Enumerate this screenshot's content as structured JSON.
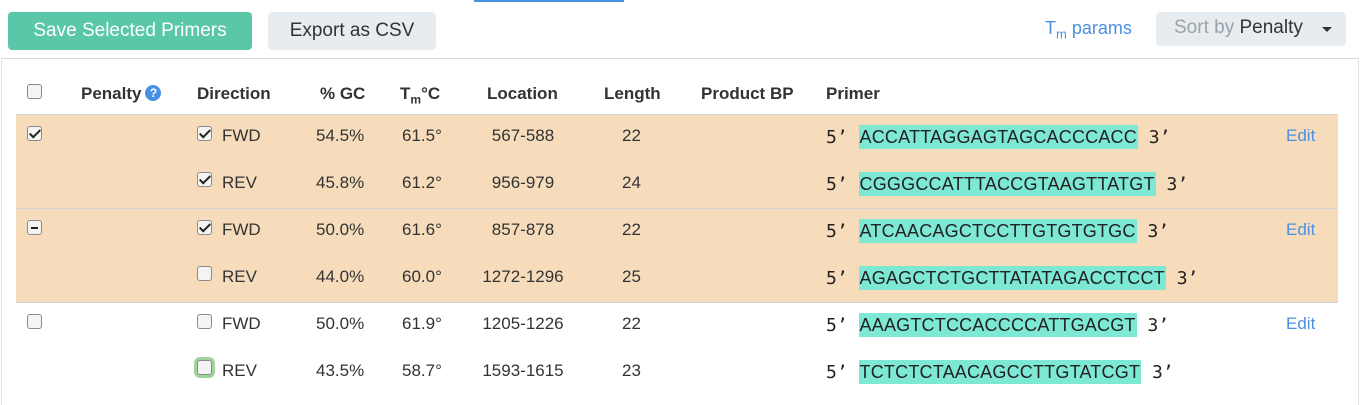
{
  "toolbar": {
    "save_label": "Save Selected Primers",
    "export_label": "Export as CSV",
    "tm_link": {
      "main": "T",
      "sub": "m",
      "rest": " params"
    },
    "sort": {
      "prefix": "Sort by ",
      "value": "Penalty"
    }
  },
  "columns": {
    "penalty": "Penalty",
    "direction": "Direction",
    "gc": "% GC",
    "tm": {
      "main": "T",
      "sub": "m",
      "rest": "°C"
    },
    "location": "Location",
    "length": "Length",
    "product_bp": "Product BP",
    "primer": "Primer"
  },
  "help_glyph": "?",
  "prime5": "5’",
  "prime3": "3’",
  "edit_label": "Edit",
  "colors": {
    "accent_green": "#5ac8a8",
    "selected_row": "#f7dcbc",
    "sequence_highlight": "#7de8d4",
    "link": "#4a90e2"
  },
  "pairs": [
    {
      "pair_state": "checked",
      "rows": [
        {
          "checked": true,
          "direction": "FWD",
          "gc": "54.5%",
          "tm": "61.5°",
          "location": "567-588",
          "length": "22",
          "product_bp": "",
          "sequence": "ACCATTAGGAGTAGCACCCACC"
        },
        {
          "checked": true,
          "direction": "REV",
          "gc": "45.8%",
          "tm": "61.2°",
          "location": "956-979",
          "length": "24",
          "product_bp": "",
          "sequence": "CGGGCCATTTACCGTAAGTTATGT"
        }
      ]
    },
    {
      "pair_state": "mixed",
      "rows": [
        {
          "checked": true,
          "direction": "FWD",
          "gc": "50.0%",
          "tm": "61.6°",
          "location": "857-878",
          "length": "22",
          "product_bp": "",
          "sequence": "ATCAACAGCTCCTTGTGTGTGC"
        },
        {
          "checked": false,
          "direction": "REV",
          "gc": "44.0%",
          "tm": "60.0°",
          "location": "1272-1296",
          "length": "25",
          "product_bp": "",
          "sequence": "AGAGCTCTGCTTATATAGACCTCCT"
        }
      ]
    },
    {
      "pair_state": "unchecked",
      "rows": [
        {
          "checked": false,
          "direction": "FWD",
          "gc": "50.0%",
          "tm": "61.9°",
          "location": "1205-1226",
          "length": "22",
          "product_bp": "",
          "sequence": "AAAGTCTCCACCCCATTGACGT"
        },
        {
          "checked": false,
          "direction": "REV",
          "gc": "43.5%",
          "tm": "58.7°",
          "location": "1593-1615",
          "length": "23",
          "product_bp": "",
          "sequence": "TCTCTCTAACAGCCTTGTATCGT"
        }
      ]
    }
  ]
}
